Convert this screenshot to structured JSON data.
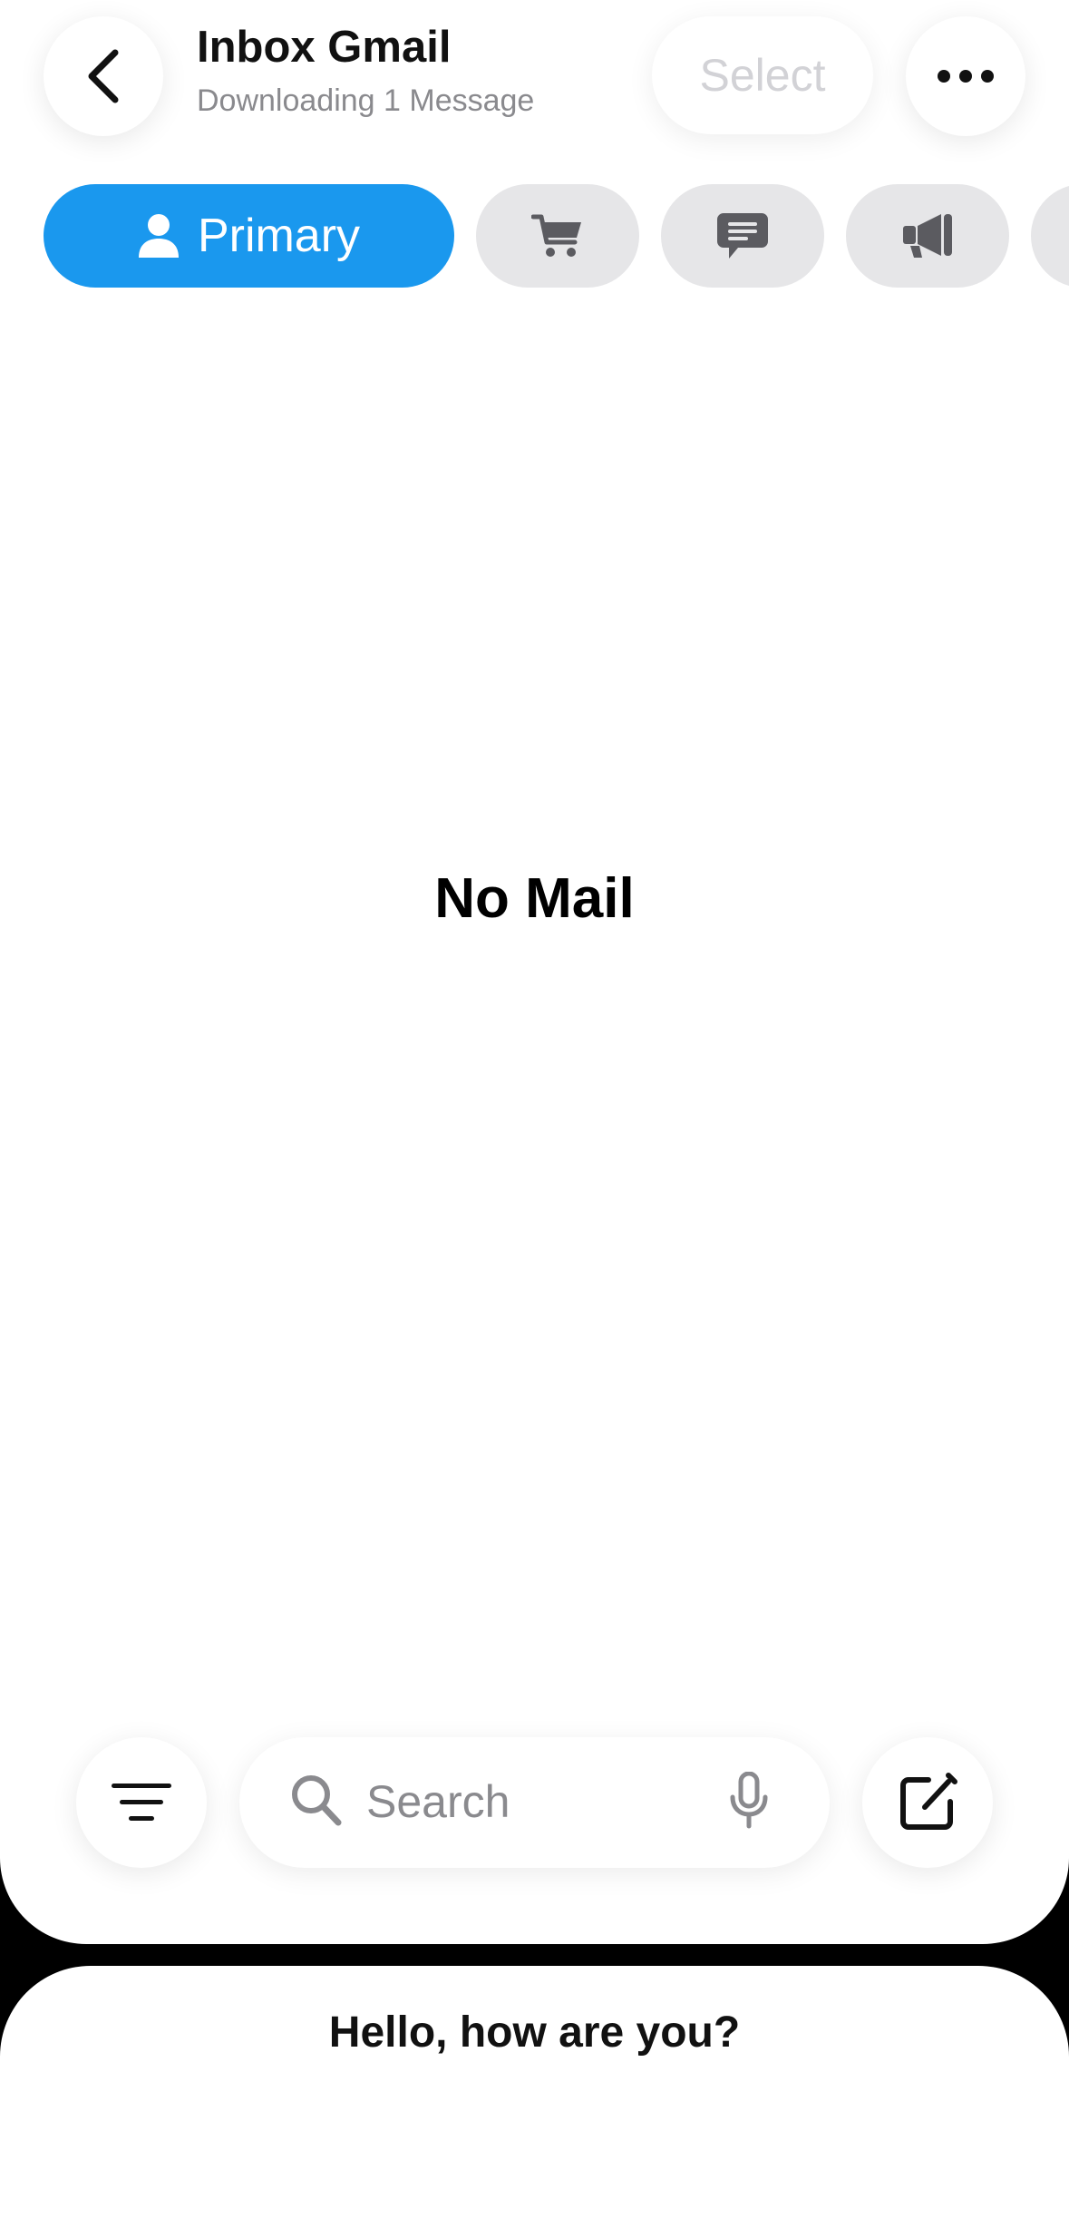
{
  "header": {
    "title": "Inbox Gmail",
    "subtitle": "Downloading 1 Message",
    "select_label": "Select"
  },
  "tabs": [
    {
      "label": "Primary",
      "icon": "person-icon",
      "selected": true
    },
    {
      "label": "",
      "icon": "cart-icon",
      "selected": false
    },
    {
      "label": "",
      "icon": "message-bubble-icon",
      "selected": false
    },
    {
      "label": "",
      "icon": "megaphone-icon",
      "selected": false
    },
    {
      "label": "",
      "icon": "partial-tab",
      "selected": false
    }
  ],
  "main": {
    "empty_text": "No Mail"
  },
  "toolbar": {
    "search_placeholder": "Search"
  },
  "sheet": {
    "message": "Hello, how are you?"
  },
  "colors": {
    "accent": "#1a98ee",
    "tab_inactive": "#e6e6e8",
    "secondary_text": "#8a8a8e"
  }
}
